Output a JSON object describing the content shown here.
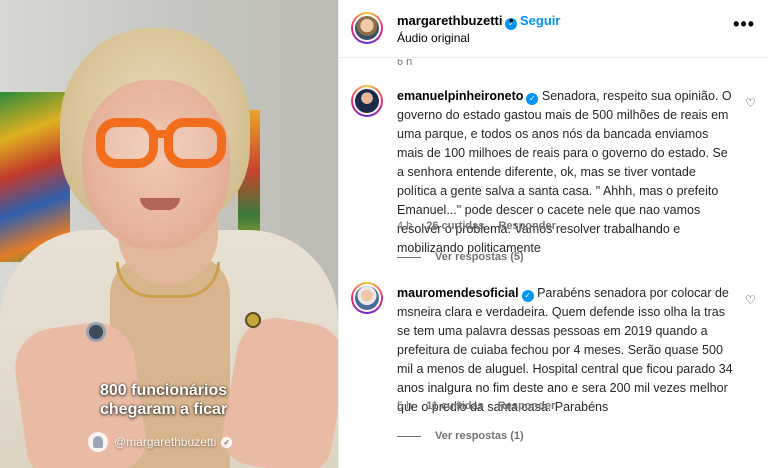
{
  "video": {
    "caption_line1": "800 funcionários",
    "caption_line2": "chegaram a ficar",
    "watermark": "@margarethbuzetti"
  },
  "post_header": {
    "username": "margarethbuzetti",
    "separator": "•",
    "follow_label": "Seguir",
    "audio": "Áudio original",
    "more_label": "•••"
  },
  "top_time": "6 h",
  "comments": [
    {
      "username": "emanuelpinheironeto",
      "text": "Senadora, respeito sua opinião. O governo do estado gastou mais de 500 milhões de reais em uma parque, e todos os anos nós da bancada enviamos mais de 100 milhoes de reais para o governo do estado. Se a senhora entende diferente, ok, mas se tiver vontade política a gente salva a santa casa. \" Ahhh, mas o prefeito Emanuel...\" pode descer o cacete nele que nao vamos resolver o problema. Vamos resolver trabalhando e mobilizando politicamente",
      "time": "4 h",
      "likes": "26 curtidas",
      "reply": "Responder",
      "view_replies": "Ver respostas (5)"
    },
    {
      "username": "mauromendesoficial",
      "text": "Parabéns senadora por colocar de msneira clara e verdadeira. Quem defende isso olha la tras se tem uma palavra dessas pessoas em 2019 quando a prefeitura de cuiaba fechou por 4 meses. Serão quase 500 mil a menos de aluguel. Hospital central que ficou parado 34 anos inalgura no fim deste ano e sera 200 mil vezes melhor que o predio da santa casa. Parabéns",
      "time": "5 h",
      "likes": "11 curtidas",
      "reply": "Responder",
      "view_replies": "Ver respostas (1)"
    }
  ],
  "icons": {
    "verified": "verified-badge-icon",
    "heart": "heart-outline-icon",
    "more": "more-options-icon"
  },
  "colors": {
    "accent": "#0095f6",
    "glasses": "#f36d1f",
    "muted_text": "#737373"
  }
}
